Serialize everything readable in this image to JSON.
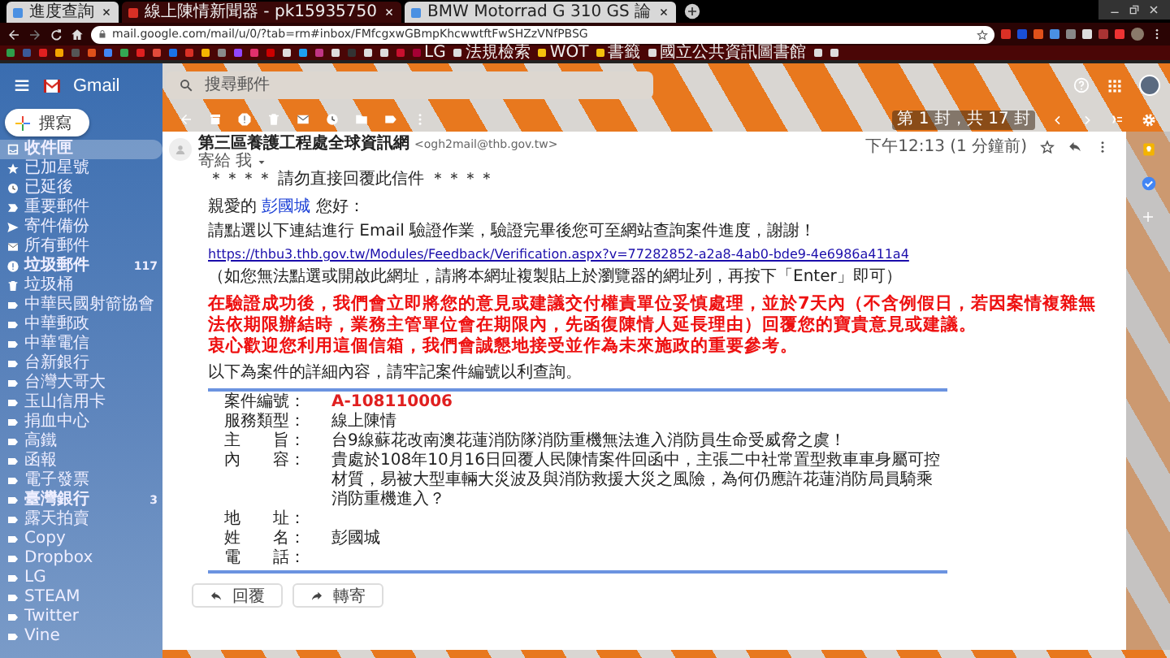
{
  "browser": {
    "tabs": [
      {
        "title": "進度查詢",
        "selected": false
      },
      {
        "title": "線上陳情新聞器 - pk15935750",
        "selected": true
      },
      {
        "title": "BMW Motorrad G 310 GS 論",
        "selected": false
      }
    ],
    "address": "mail.google.com/mail/u/0/?tab=rm#inbox/FMfcgxwGBmpKhcwwtftFwSHZzVNfPBSG",
    "bookmarks": [
      {
        "color": "#2e9e4a"
      },
      {
        "color": "#3b5998"
      },
      {
        "color": "#e02020"
      },
      {
        "color": "#f4a300"
      },
      {
        "color": "#555555"
      },
      {
        "color": "#e0501a"
      },
      {
        "color": "#4285f4"
      },
      {
        "color": "#34a853"
      },
      {
        "color": "#e02020"
      },
      {
        "color": "#e24a3a"
      },
      {
        "color": "#1a73e8"
      },
      {
        "color": "#d93025"
      },
      {
        "color": "#f4b400"
      },
      {
        "color": "#8a8a8a"
      },
      {
        "color": "#9146ff"
      },
      {
        "color": "#e1306c"
      },
      {
        "color": "#cc0000"
      },
      {
        "color": "#dddddd"
      },
      {
        "color": "#1da1f2"
      },
      {
        "color": "#c13584"
      },
      {
        "color": "#dddddd"
      },
      {
        "color": "#333333"
      },
      {
        "color": "#dddddd"
      },
      {
        "color": "#dddddd"
      },
      {
        "color": "#c8102e"
      },
      {
        "label": "LG",
        "color": "#a50034"
      },
      {
        "label": "法規檢索",
        "color": "#dddddd"
      },
      {
        "label": "WOT",
        "color": "#f4c20d"
      },
      {
        "label": "書籤",
        "color": "#f4c20d"
      },
      {
        "label": "國立公共資訊圖書館",
        "color": "#dddddd"
      },
      {
        "color": "#dddddd"
      },
      {
        "color": "#dddddd"
      }
    ]
  },
  "gmail": {
    "logo": "Gmail",
    "search": {
      "placeholder": "搜尋郵件"
    },
    "compose": "撰寫",
    "sidebar": {
      "items": [
        {
          "label": "收件匣",
          "kind": "inbox",
          "selected": true,
          "bold": true
        },
        {
          "label": "已加星號",
          "kind": "star",
          "selected": false,
          "bold": false
        },
        {
          "label": "已延後",
          "kind": "clock",
          "selected": false,
          "bold": false
        },
        {
          "label": "重要郵件",
          "kind": "important",
          "selected": false,
          "bold": false
        },
        {
          "label": "寄件備份",
          "kind": "send",
          "selected": false,
          "bold": false
        },
        {
          "label": "所有郵件",
          "kind": "mail",
          "selected": false,
          "bold": false
        },
        {
          "label": "垃圾郵件",
          "kind": "spam",
          "selected": false,
          "bold": true,
          "count": "117"
        },
        {
          "label": "垃圾桶",
          "kind": "trash",
          "selected": false,
          "bold": false
        },
        {
          "label": "中華民國射箭協會",
          "kind": "label",
          "selected": false,
          "bold": false
        },
        {
          "label": "中華郵政",
          "kind": "label",
          "selected": false,
          "bold": false
        },
        {
          "label": "中華電信",
          "kind": "label",
          "selected": false,
          "bold": false
        },
        {
          "label": "台新銀行",
          "kind": "label",
          "selected": false,
          "bold": false
        },
        {
          "label": "台灣大哥大",
          "kind": "label",
          "selected": false,
          "bold": false
        },
        {
          "label": "玉山信用卡",
          "kind": "label",
          "selected": false,
          "bold": false
        },
        {
          "label": "捐血中心",
          "kind": "label",
          "selected": false,
          "bold": false
        },
        {
          "label": "高鐵",
          "kind": "label",
          "selected": false,
          "bold": false
        },
        {
          "label": "函報",
          "kind": "label",
          "selected": false,
          "bold": false
        },
        {
          "label": "電子發票",
          "kind": "label",
          "selected": false,
          "bold": false
        },
        {
          "label": "臺灣銀行",
          "kind": "label",
          "selected": false,
          "bold": true,
          "count": "3"
        },
        {
          "label": "露天拍賣",
          "kind": "label",
          "selected": false,
          "bold": false
        },
        {
          "label": "Copy",
          "kind": "label",
          "selected": false,
          "bold": false
        },
        {
          "label": "Dropbox",
          "kind": "label",
          "selected": false,
          "bold": false
        },
        {
          "label": "LG",
          "kind": "label",
          "selected": false,
          "bold": false
        },
        {
          "label": "STEAM",
          "kind": "label",
          "selected": false,
          "bold": false
        },
        {
          "label": "Twitter",
          "kind": "label",
          "selected": false,
          "bold": false
        },
        {
          "label": "Vine",
          "kind": "label",
          "selected": false,
          "bold": false
        }
      ]
    },
    "toolbar": {
      "position": "第 1 封，共 17 封"
    },
    "message": {
      "sender_name": "第三區養護工程處全球資訊網",
      "sender_email": "<ogh2mail@thb.gov.tw>",
      "recipient": "寄給 我",
      "time": "下午12:13 (1 分鐘前)",
      "notice": "＊＊＊＊ 請勿直接回覆此信件 ＊＊＊＊",
      "greeting": {
        "before": "親愛的",
        "name": "彭國城",
        "after": "您好："
      },
      "instruction": "請點選以下連結進行 Email 驗證作業，驗證完畢後您可至網站查詢案件進度，謝謝！",
      "link": "https://thbu3.thb.gov.tw/Modules/Feedback/Verification.aspx?v=77282852-a2a8-4ab0-bde9-4e6986a411a4",
      "link_note": "（如您無法點選或開啟此網址，請將本網址複製貼上於瀏覽器的網址列，再按下「Enter」即可）",
      "highlight": [
        "在驗證成功後，我們會立即將您的意見或建議交付權責單位妥慎處理，並於7天內（不含例假日，若因案情複雜無法依期限辦結時，業務主管單位會在期限內，先函復陳情人延長理由）回覆您的寶貴意見或建議。",
        "衷心歡迎您利用這個信箱，我們會誠懇地接受並作為未來施政的重要參考。"
      ],
      "details_intro": "以下為案件的詳細內容，請牢記案件編號以利查詢。",
      "fields": [
        {
          "label": "案件編號：",
          "value": "A-108110006",
          "kind": "id"
        },
        {
          "label": "服務類型：",
          "value": "線上陳情",
          "kind": "text"
        },
        {
          "label": "主　　旨：",
          "value": "台9線蘇花改南澳花蓮消防隊消防重機無法進入消防員生命受威脅之虞！",
          "kind": "text"
        },
        {
          "label": "內　　容：",
          "value": "貴處於108年10月16日回覆人民陳情案件回函中，主張二中社常置型救車車身屬可控材質，易被大型車輛大災波及與消防救援大災之風險，為何仍應許花蓮消防局員騎乘消防重機進入？",
          "kind": "text"
        },
        {
          "label": "地　　址：",
          "kind": "text"
        },
        {
          "label": "姓　　名：",
          "value": "彭國城",
          "kind": "text"
        },
        {
          "label": "電　　話：",
          "kind": "text"
        }
      ],
      "buttons": [
        {
          "label": "回覆",
          "kind": "reply"
        },
        {
          "label": "轉寄",
          "kind": "forward"
        }
      ]
    }
  }
}
